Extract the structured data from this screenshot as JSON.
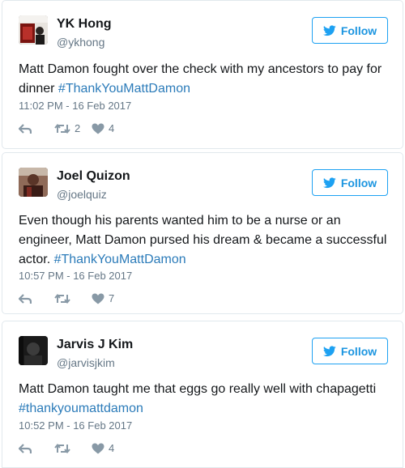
{
  "tweets": [
    {
      "name": "YK Hong",
      "handle": "@ykhong",
      "follow_label": "Follow",
      "text": "Matt Damon fought over the check with my ancestors to pay for dinner ",
      "hashtag": "#ThankYouMattDamon",
      "time": "11:02 PM - 16 Feb 2017",
      "retweets": "2",
      "likes": "4"
    },
    {
      "name": "Joel Quizon",
      "handle": "@joelquiz",
      "follow_label": "Follow",
      "text": "Even though his parents wanted him to be a nurse or an engineer, Matt Damon pursed his dream & became a successful actor. ",
      "hashtag": "#ThankYouMattDamon",
      "time": "10:57 PM - 16 Feb 2017",
      "retweets": "",
      "likes": "7"
    },
    {
      "name": "Jarvis J Kim",
      "handle": "@jarvisjkim",
      "follow_label": "Follow",
      "text": "Matt Damon taught me that eggs go really well with chapagetti ",
      "hashtag": "#thankyoumattdamon",
      "time": "10:52 PM - 16 Feb 2017",
      "retweets": "",
      "likes": "4"
    }
  ],
  "icons": {
    "follow": "twitter-bird-icon",
    "reply": "reply-icon",
    "retweet": "retweet-icon",
    "like": "heart-icon"
  },
  "colors": {
    "accent": "#1da1f2",
    "link": "#2b7bb9",
    "muted": "#657786",
    "border": "#e1e8ed"
  }
}
